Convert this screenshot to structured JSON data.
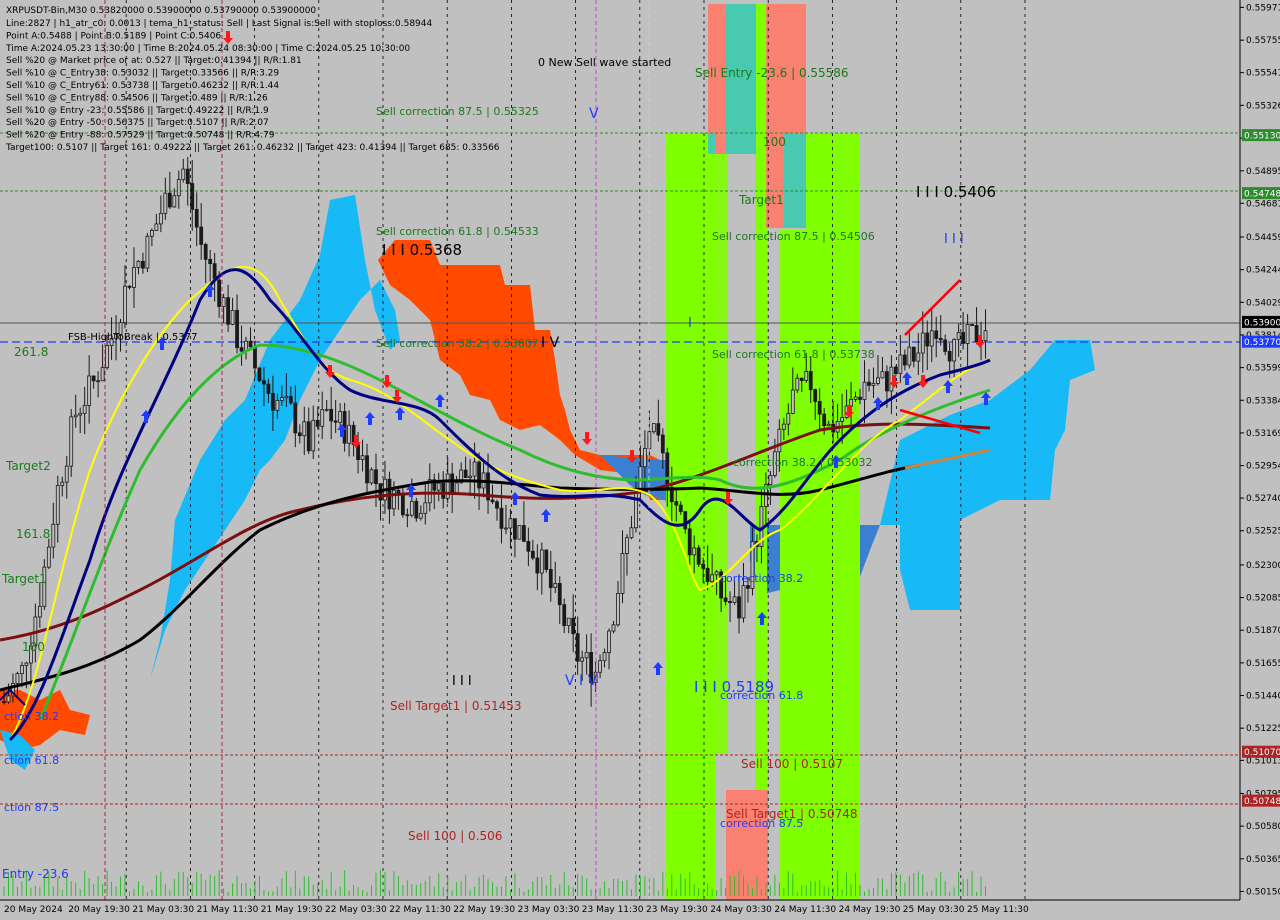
{
  "header": {
    "symbol_line": "XRPUSDT-Bin,M30  0.53820000 0.53900000 0.53790000 0.53900000",
    "lines": [
      "Line:2827 | h1_atr_c0: 0.0013 | tema_h1_status: Sell | Last Signal is:Sell with stoploss:0.58944",
      "Point A:0.5488 | Point B:0.5189 | Point C:0.5406",
      "Time A:2024.05.23 13:30:00 | Time B:2024.05.24 08:30:00 | Time C:2024.05.25 10:30:00",
      "Sell %20 @ Market price or at: 0.527 || Target:0.41394 || R/R:1.81",
      "Sell %10 @ C_Entry38: 0.53032 || Target:0.33566 || R/R:3.29",
      "Sell %10 @ C_Entry61: 0.53738 || Target:0.46232 || R/R:1.44",
      "Sell %10 @ C_Entry88: 0.54506 || Target:0.489 || R/R:1.26",
      "Sell %10 @ Entry -23: 0.55586 || Target:0.49222 || R/R:1.9",
      "Sell %20 @ Entry -50: 0.56375 || Target:0.5107 || R/R:2.07",
      "Sell %20 @ Entry -88: 0.57529 || Target:0.50748 || R/R:4.79",
      "Target100: 0.5107 || Target 161: 0.49222 || Target 261: 0.46232 || Target 423: 0.41394 || Target 685: 0.33566"
    ]
  },
  "annotations": {
    "new_wave": "0 New Sell wave started",
    "sell_entry": "Sell Entry -23.6 | 0.55586",
    "sell_corr_875_left": "Sell correction 87.5 | 0.55325",
    "sell_corr_618_left": "Sell correction 61.8 | 0.54533",
    "sell_corr_382_left": "Sell correction 38.2 | 0.53807",
    "sell_corr_875_right": "Sell correction 87.5 | 0.54506",
    "sell_corr_618_right": "Sell correction 61.8 | 0.53738",
    "sell_corr_382_right": "correction 38.2 | 0.53032",
    "wave_5368": "I I I 0.5368",
    "wave_5406": "I I I 0.5406",
    "wave_5189": "I I I 0.5189",
    "iii_right": "I I I",
    "iii_mid": "I I I",
    "v_mark": "V",
    "iv_mark": "I V",
    "i_mark": "I",
    "vi_mark": "V I V",
    "hundred": "100",
    "target1_top": "Target1",
    "sell_target1_left": "Sell Target1 | 0.51453",
    "sell_100_left": "Sell 100 | 0.506",
    "sell_100_right": "Sell 100 | 0.5107",
    "sell_target1_right": "Sell Target1 | 0.50748",
    "correction_382": "correction 38.2",
    "correction_618": "correction 61.8",
    "correction_875": "correction 87.5",
    "fsb": "FSB-HighToBreak | 0.5377",
    "left_2618": "261.8",
    "left_target2": "Target2",
    "left_1618": "161.8",
    "left_target1": "Target1",
    "left_100": "100",
    "left_ction382": "ction 38.2",
    "left_ction618": "ction 61.8",
    "left_ction875": "ction 87.5",
    "left_entry": "Entry -23.6",
    "left_4": "1.4"
  },
  "price_tags": [
    {
      "value": "0.55130",
      "color": "#2e8b2e"
    },
    {
      "value": "0.54748",
      "color": "#2e8b2e"
    },
    {
      "value": "0.53900",
      "color": "#000000"
    },
    {
      "value": "0.53770",
      "color": "#1e3cff"
    },
    {
      "value": "0.51070",
      "color": "#b22222"
    },
    {
      "value": "0.50748",
      "color": "#b22222"
    }
  ],
  "chart_data": {
    "type": "candlestick",
    "symbol": "XRPUSDT-Bin",
    "timeframe": "M30",
    "ylim": [
      0.5012,
      0.5598
    ],
    "y_ticks": [
      "0.55971",
      "0.55755",
      "0.55541",
      "0.55326",
      "0.55110",
      "0.54895",
      "0.54681",
      "0.54459",
      "0.54244",
      "0.54029",
      "0.53814",
      "0.53599",
      "0.53384",
      "0.53169",
      "0.52954",
      "0.52740",
      "0.52525",
      "0.52300",
      "0.52085",
      "0.51870",
      "0.51655",
      "0.51440",
      "0.51225",
      "0.51013",
      "0.50795",
      "0.50580",
      "0.50365",
      "0.50150"
    ],
    "x_ticks": [
      "20 May 2024",
      "20 May 19:30",
      "21 May 03:30",
      "21 May 11:30",
      "21 May 19:30",
      "22 May 03:30",
      "22 May 11:30",
      "22 May 19:30",
      "23 May 03:30",
      "23 May 11:30",
      "23 May 19:30",
      "24 May 03:30",
      "24 May 11:30",
      "24 May 19:30",
      "25 May 03:30",
      "25 May 11:30"
    ],
    "last_price": 0.539,
    "levels": [
      {
        "label": "Entry -23.6",
        "value": 0.5513
      },
      {
        "label": "Target1",
        "value": 0.54748
      },
      {
        "label": "FSB-HighToBreak",
        "value": 0.5377
      },
      {
        "label": "Sell 100",
        "value": 0.5107
      },
      {
        "label": "Sell Target1",
        "value": 0.50748
      }
    ],
    "close_path": [
      [
        0,
        0.514
      ],
      [
        4,
        0.516
      ],
      [
        8,
        0.521
      ],
      [
        12,
        0.528
      ],
      [
        16,
        0.533
      ],
      [
        20,
        0.535
      ],
      [
        24,
        0.538
      ],
      [
        28,
        0.542
      ],
      [
        32,
        0.544
      ],
      [
        36,
        0.547
      ],
      [
        40,
        0.549
      ],
      [
        44,
        0.544
      ],
      [
        48,
        0.541
      ],
      [
        52,
        0.538
      ],
      [
        56,
        0.536
      ],
      [
        60,
        0.534
      ],
      [
        64,
        0.533
      ],
      [
        68,
        0.531
      ],
      [
        72,
        0.533
      ],
      [
        76,
        0.532
      ],
      [
        80,
        0.53
      ],
      [
        84,
        0.528
      ],
      [
        88,
        0.5275
      ],
      [
        92,
        0.527
      ],
      [
        96,
        0.528
      ],
      [
        100,
        0.5285
      ],
      [
        104,
        0.529
      ],
      [
        108,
        0.528
      ],
      [
        112,
        0.526
      ],
      [
        116,
        0.525
      ],
      [
        120,
        0.523
      ],
      [
        124,
        0.52
      ],
      [
        128,
        0.517
      ],
      [
        132,
        0.516
      ],
      [
        136,
        0.52
      ],
      [
        140,
        0.526
      ],
      [
        144,
        0.532
      ],
      [
        148,
        0.529
      ],
      [
        152,
        0.525
      ],
      [
        156,
        0.523
      ],
      [
        160,
        0.521
      ],
      [
        164,
        0.52
      ],
      [
        168,
        0.525
      ],
      [
        172,
        0.53
      ],
      [
        176,
        0.534
      ],
      [
        180,
        0.535
      ],
      [
        184,
        0.532
      ],
      [
        188,
        0.533
      ],
      [
        192,
        0.535
      ],
      [
        196,
        0.535
      ],
      [
        200,
        0.536
      ],
      [
        204,
        0.537
      ],
      [
        208,
        0.539
      ],
      [
        212,
        0.537
      ],
      [
        216,
        0.538
      ],
      [
        220,
        0.539
      ]
    ],
    "series": [
      {
        "name": "",
        "color": "#ffff00"
      },
      {
        "name": "",
        "color": "#000080"
      },
      {
        "name": "",
        "color": "#2ebd2e"
      },
      {
        "name": "",
        "color": "#7a1010"
      },
      {
        "name": "",
        "color": "#000000"
      }
    ]
  }
}
